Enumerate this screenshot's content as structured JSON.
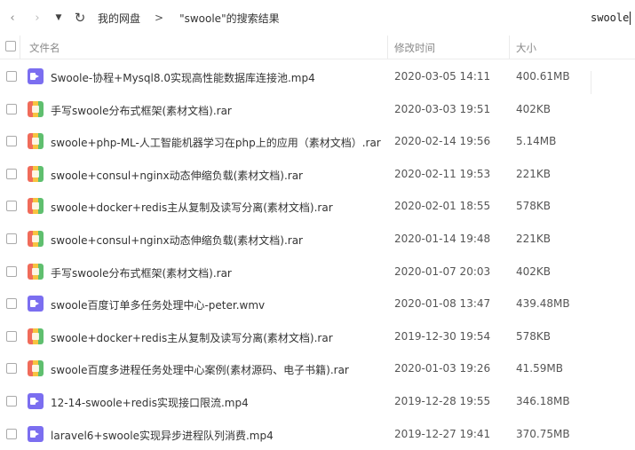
{
  "nav": {
    "back_glyph": "‹",
    "forward_glyph": "›",
    "dropdown_glyph": "▼",
    "refresh_glyph": "↻"
  },
  "breadcrumb": {
    "root": "我的网盘",
    "separator": ">",
    "current": "\"swoole\"的搜索结果"
  },
  "search": {
    "value": "swoole"
  },
  "columns": {
    "name": "文件名",
    "date": "修改时间",
    "size": "大小"
  },
  "files": [
    {
      "icon": "video",
      "name": "Swoole-协程+Mysql8.0实现高性能数据库连接池.mp4",
      "date": "2020-03-05 14:11",
      "size": "400.61MB"
    },
    {
      "icon": "rar",
      "name": "手写swoole分布式框架(素材文档).rar",
      "date": "2020-03-03 19:51",
      "size": "402KB"
    },
    {
      "icon": "rar",
      "name": "swoole+php-ML-人工智能机器学习在php上的应用（素材文档）.rar",
      "date": "2020-02-14 19:56",
      "size": "5.14MB"
    },
    {
      "icon": "rar",
      "name": "swoole+consul+nginx动态伸缩负载(素材文档).rar",
      "date": "2020-02-11 19:53",
      "size": "221KB"
    },
    {
      "icon": "rar",
      "name": "swoole+docker+redis主从复制及读写分离(素材文档).rar",
      "date": "2020-02-01 18:55",
      "size": "578KB"
    },
    {
      "icon": "rar",
      "name": "swoole+consul+nginx动态伸缩负载(素材文档).rar",
      "date": "2020-01-14 19:48",
      "size": "221KB"
    },
    {
      "icon": "rar",
      "name": "手写swoole分布式框架(素材文档).rar",
      "date": "2020-01-07 20:03",
      "size": "402KB"
    },
    {
      "icon": "video",
      "name": "swoole百度订单多任务处理中心-peter.wmv",
      "date": "2020-01-08 13:47",
      "size": "439.48MB"
    },
    {
      "icon": "rar",
      "name": "swoole+docker+redis主从复制及读写分离(素材文档).rar",
      "date": "2019-12-30 19:54",
      "size": "578KB"
    },
    {
      "icon": "rar",
      "name": "swoole百度多进程任务处理中心案例(素材源码、电子书籍).rar",
      "date": "2020-01-03 19:26",
      "size": "41.59MB"
    },
    {
      "icon": "video",
      "name": "12-14-swoole+redis实现接口限流.mp4",
      "date": "2019-12-28 19:55",
      "size": "346.18MB"
    },
    {
      "icon": "video",
      "name": "laravel6+swoole实现异步进程队列消费.mp4",
      "date": "2019-12-27 19:41",
      "size": "370.75MB"
    }
  ]
}
